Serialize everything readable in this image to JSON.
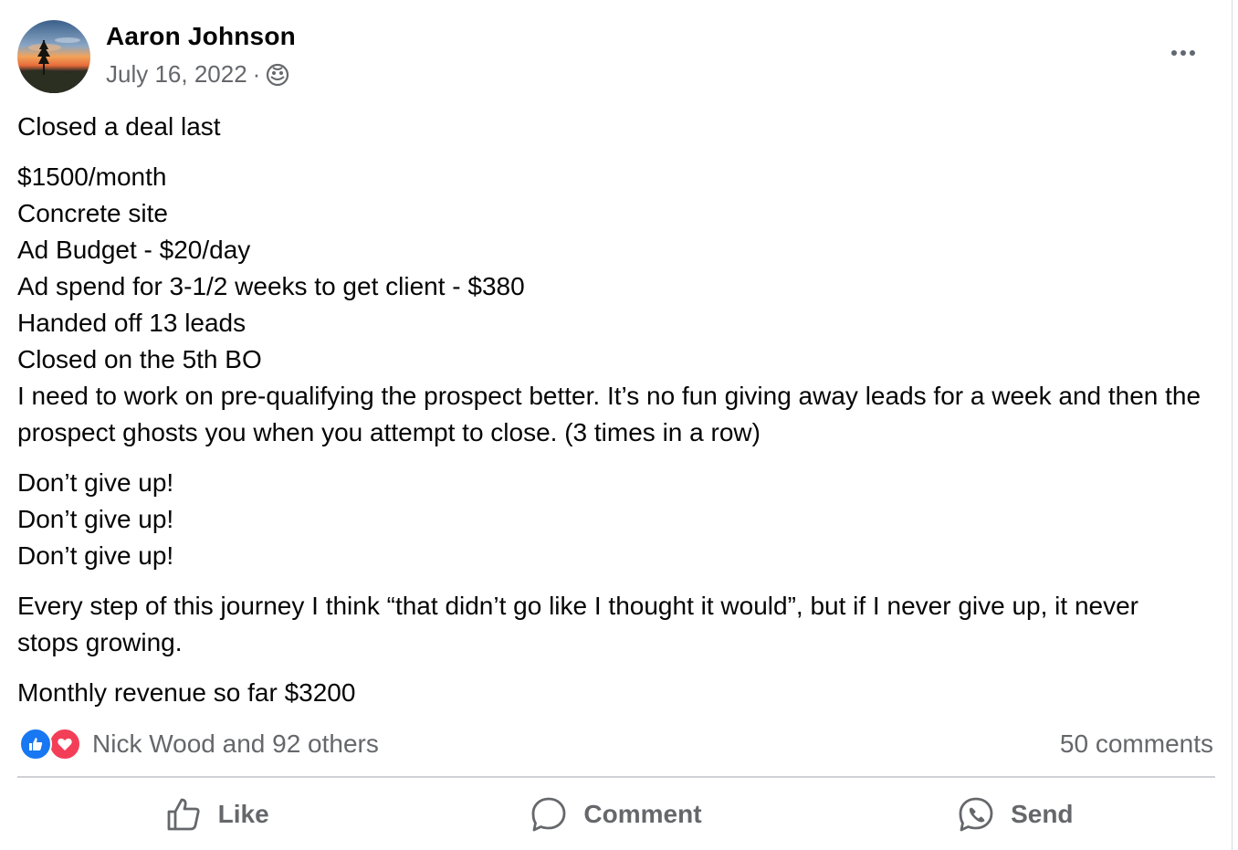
{
  "post": {
    "author": "Aaron Johnson",
    "date": "July 16, 2022",
    "separator": "·",
    "audience_icon": "public-globe-icon",
    "paragraphs": [
      [
        "Closed a deal last"
      ],
      [
        "$1500/month",
        "Concrete site",
        "Ad Budget - $20/day",
        "Ad spend for 3-1/2 weeks to get client - $380",
        "Handed off 13 leads",
        "Closed on the 5th BO",
        "I need to work on pre-qualifying the prospect better. It’s no fun giving away leads for a week and then the prospect ghosts you when you attempt to close. (3 times in a row)"
      ],
      [
        "Don’t give up!",
        "Don’t give up!",
        "Don’t give up!"
      ],
      [
        "Every step of this journey I think “that didn’t go like I thought it would”, but if I never give up, it never stops growing."
      ],
      [
        "Monthly revenue so far $3200"
      ]
    ]
  },
  "footer": {
    "reactions_text": "Nick Wood and 92 others",
    "reaction_icons": [
      "like-reaction-icon",
      "love-reaction-icon"
    ],
    "comments_text": "50 comments"
  },
  "actions": {
    "like": "Like",
    "comment": "Comment",
    "send": "Send"
  },
  "colors": {
    "text_primary": "#050505",
    "text_secondary": "#65676b",
    "like_blue": "#1877f2",
    "love_red": "#f33e58"
  }
}
